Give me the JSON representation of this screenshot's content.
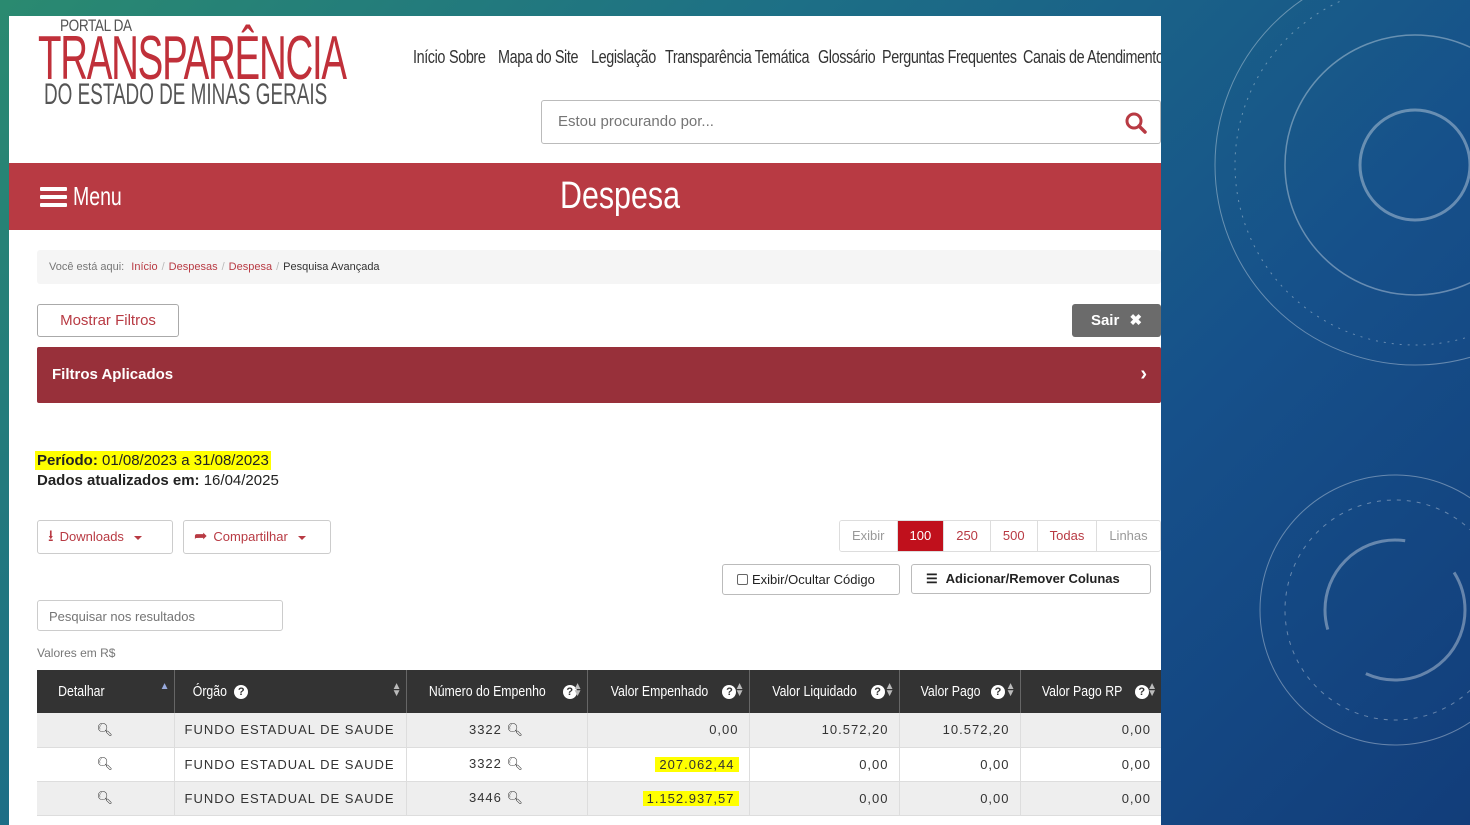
{
  "colors": {
    "brand_red": "#b83a43",
    "dark_red": "#98303a",
    "highlight": "#ffff00",
    "header_dark": "#333333"
  },
  "logo": {
    "top": "PORTAL DA",
    "main": "TRANSPARÊNCIA",
    "sub": "DO ESTADO DE MINAS GERAIS"
  },
  "nav": [
    "Início",
    "Sobre",
    "Mapa do Site",
    "Legislação",
    "Transparência Temática",
    "Glossário",
    "Perguntas Frequentes",
    "Canais de Atendimento"
  ],
  "search": {
    "placeholder": "Estou procurando por..."
  },
  "menu_label": "Menu",
  "page_title": "Despesa",
  "breadcrumb": {
    "prefix": "Você está aqui:",
    "items": [
      "Início",
      "Despesas",
      "Despesa"
    ],
    "current": "Pesquisa Avançada"
  },
  "buttons": {
    "mostrar_filtros": "Mostrar Filtros",
    "sair": "Sair",
    "filtros_aplicados": "Filtros Aplicados",
    "downloads": "Downloads",
    "compartilhar": "Compartilhar",
    "exibir_codigo": "Exibir/Ocultar Código",
    "colunas": "Adicionar/Remover Colunas"
  },
  "info": {
    "periodo_label": "Período:",
    "periodo_value": "01/08/2023 a 31/08/2023",
    "atualizados_label": "Dados atualizados em:",
    "atualizados_value": "16/04/2025"
  },
  "pager": {
    "prefix": "Exibir",
    "options": [
      "100",
      "250",
      "500",
      "Todas"
    ],
    "selected": "100",
    "suffix": "Linhas"
  },
  "results_search": {
    "placeholder": "Pesquisar nos resultados"
  },
  "units_note": "Valores em R$",
  "table": {
    "headers": [
      "Detalhar",
      "Órgão",
      "Número do Empenho",
      "Valor Empenhado",
      "Valor Liquidado",
      "Valor Pago",
      "Valor Pago RP"
    ],
    "rows": [
      {
        "orgao": "FUNDO ESTADUAL DE SAUDE",
        "empenho": "3322",
        "empenhado": "0,00",
        "liquidado": "10.572,20",
        "pago": "10.572,20",
        "pago_rp": "0,00"
      },
      {
        "orgao": "FUNDO ESTADUAL DE SAUDE",
        "empenho": "3322",
        "empenhado": "207.062,44",
        "liquidado": "0,00",
        "pago": "0,00",
        "pago_rp": "0,00"
      },
      {
        "orgao": "FUNDO ESTADUAL DE SAUDE",
        "empenho": "3446",
        "empenhado": "1.152.937,57",
        "liquidado": "0,00",
        "pago": "0,00",
        "pago_rp": "0,00"
      }
    ]
  }
}
